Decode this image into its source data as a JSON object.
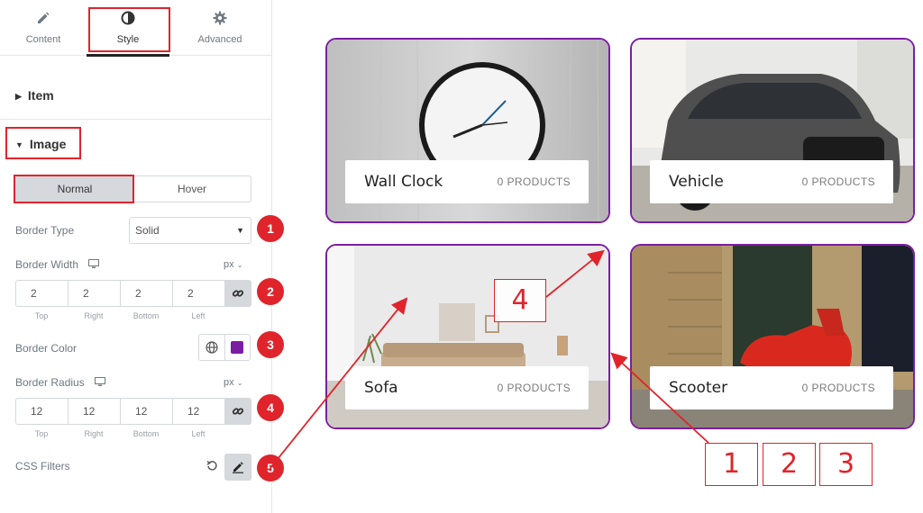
{
  "tabs": [
    {
      "label": "Content",
      "icon": "pencil-icon"
    },
    {
      "label": "Style",
      "icon": "half-circle-icon"
    },
    {
      "label": "Advanced",
      "icon": "gear-icon"
    }
  ],
  "sections": {
    "item": "Item",
    "image": "Image"
  },
  "state_toggle": {
    "normal": "Normal",
    "hover": "Hover"
  },
  "border_type": {
    "label": "Border Type",
    "value": "Solid"
  },
  "border_width": {
    "label": "Border Width",
    "unit": "px",
    "values": [
      "2",
      "2",
      "2",
      "2"
    ],
    "sides": [
      "Top",
      "Right",
      "Bottom",
      "Left"
    ]
  },
  "border_color": {
    "label": "Border Color",
    "color": "#7a1ea1"
  },
  "border_radius": {
    "label": "Border Radius",
    "unit": "px",
    "values": [
      "12",
      "12",
      "12",
      "12"
    ],
    "sides": [
      "Top",
      "Right",
      "Bottom",
      "Left"
    ]
  },
  "css_filters": {
    "label": "CSS Filters"
  },
  "badges": [
    "1",
    "2",
    "3",
    "4",
    "5"
  ],
  "cards": [
    {
      "name": "Wall Clock",
      "count": "0 PRODUCTS"
    },
    {
      "name": "Vehicle",
      "count": "0 PRODUCTS"
    },
    {
      "name": "Sofa",
      "count": "0 PRODUCTS"
    },
    {
      "name": "Scooter",
      "count": "0 PRODUCTS"
    }
  ],
  "callouts": [
    "4",
    "1",
    "2",
    "3"
  ],
  "colors": {
    "accent_red": "#e0242b",
    "border_purple": "#7a1ea1"
  }
}
